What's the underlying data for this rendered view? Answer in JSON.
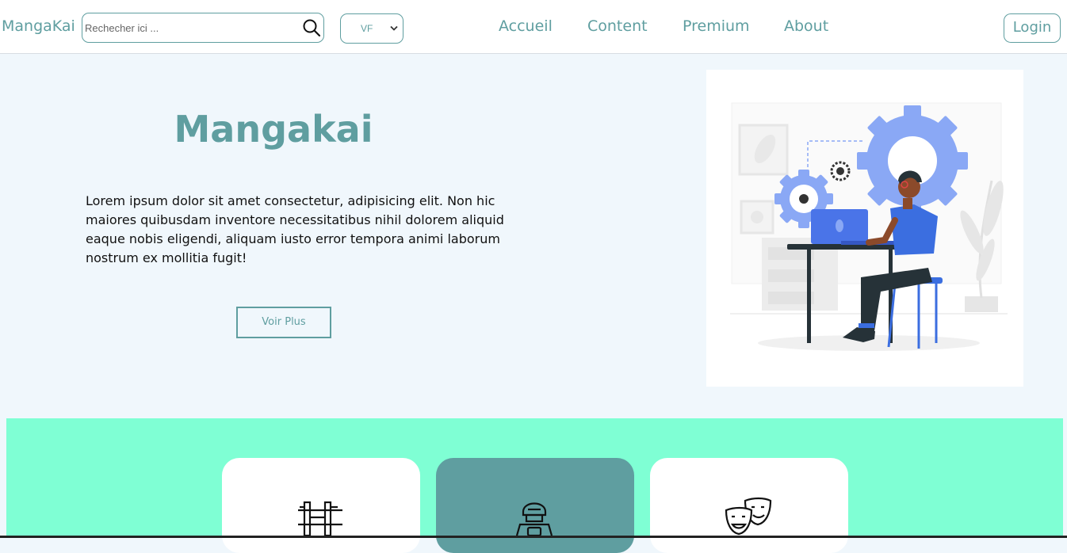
{
  "header": {
    "brand": "MangaKai",
    "search": {
      "placeholder": "Rechecher ici ...",
      "value": ""
    },
    "language": {
      "selected": "VF"
    },
    "nav": [
      "Accueil",
      "Content",
      "Premium",
      "About"
    ],
    "login_label": "Login"
  },
  "hero": {
    "title": "Mangakai",
    "text": "Lorem ipsum dolor sit amet consectetur, adipisicing elit. Non hic maiores quibusdam inventore necessitatibus nihil dolorem aliquid eaque nobis eligendi, aliquam iusto error tempora animi laborum nostrum ex mollitia fugit!",
    "button_label": "Voir Plus"
  },
  "features": {
    "cards": [
      {
        "icon": "torii-gate-icon",
        "active": false
      },
      {
        "icon": "robot-icon",
        "active": true
      },
      {
        "icon": "theater-masks-icon",
        "active": false
      }
    ]
  },
  "colors": {
    "accent": "#5f9ea0",
    "page_background": "#f0f7fc",
    "band": "#7fffd4",
    "illustration_blue": "#8aa8f5"
  }
}
